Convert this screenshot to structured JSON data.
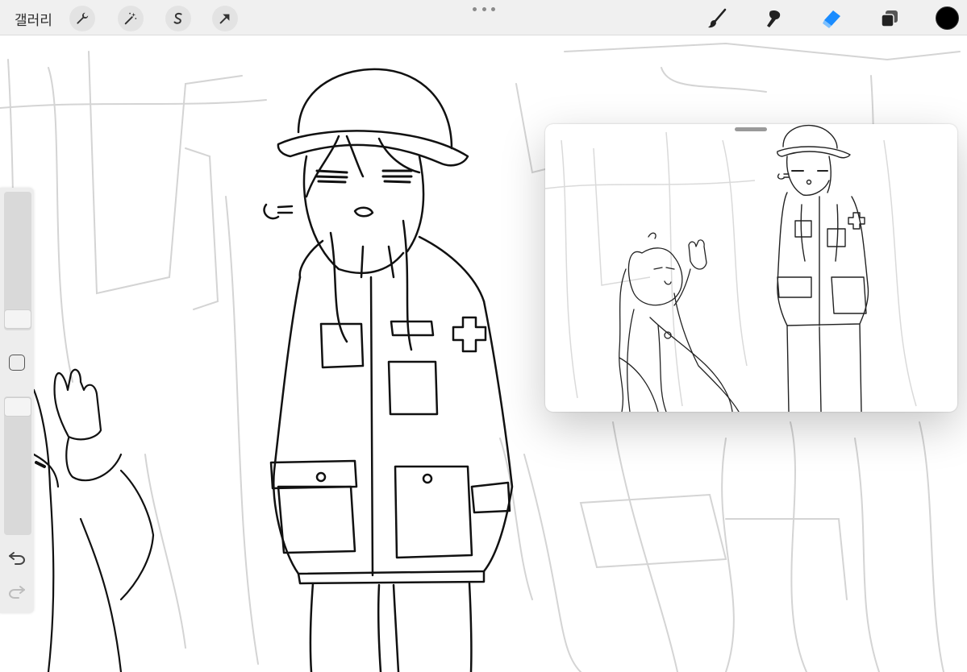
{
  "toolbar": {
    "gallery_label": "갤러리",
    "left_tools": [
      {
        "icon": "wrench-icon",
        "name": "actions-button"
      },
      {
        "icon": "magic-wand-icon",
        "name": "adjustments-button"
      },
      {
        "icon": "selection-s-icon",
        "name": "selection-button"
      },
      {
        "icon": "arrow-cursor-icon",
        "name": "transform-button"
      }
    ],
    "right_tools": [
      {
        "icon": "brush-icon",
        "name": "brush-tool-button",
        "active": false
      },
      {
        "icon": "smudge-icon",
        "name": "smudge-tool-button",
        "active": false
      },
      {
        "icon": "eraser-icon",
        "name": "eraser-tool-button",
        "active": true
      },
      {
        "icon": "layers-icon",
        "name": "layers-button",
        "active": false
      }
    ],
    "current_color": "#000000"
  },
  "sidebar": {
    "brush_size_level": 0.05,
    "opacity_level": 0.95,
    "undo_icon": "undo-icon",
    "redo_icon": "redo-icon"
  },
  "colors": {
    "toolbar_bg": "#f0f0f0",
    "active_tool": "#1a8cff",
    "ink": "#111111",
    "sketch": "#cfcfcf"
  }
}
